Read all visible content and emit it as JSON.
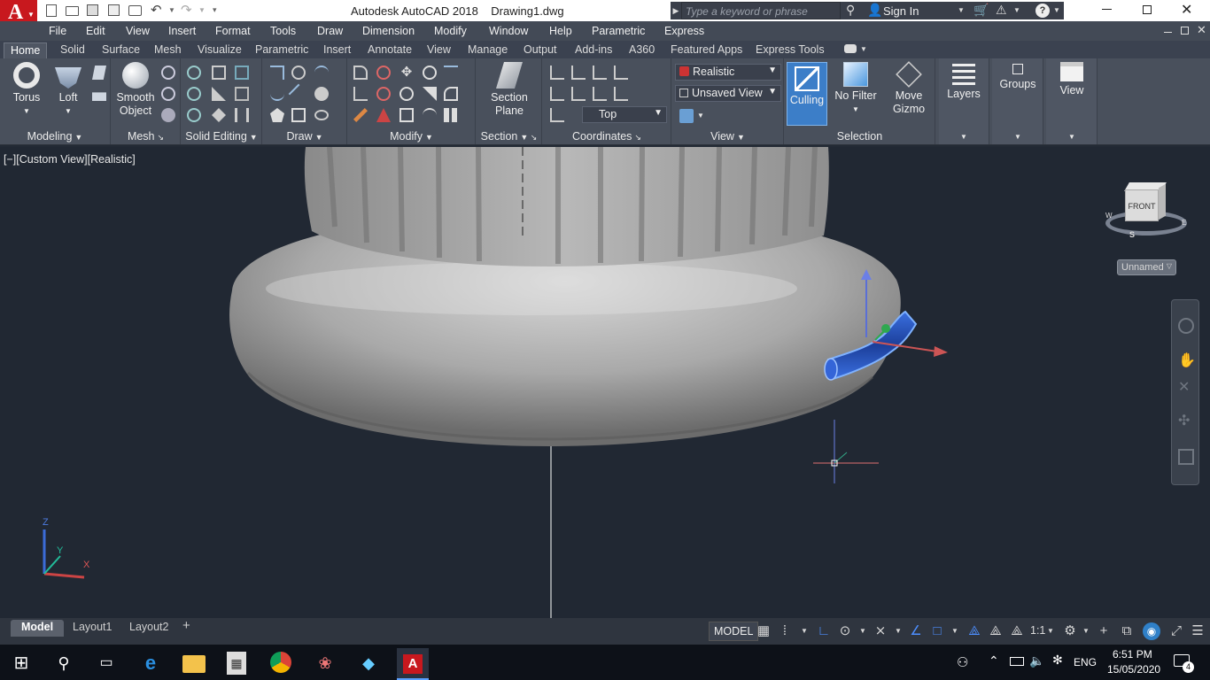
{
  "titlebar": {
    "app_title": "Autodesk AutoCAD 2018",
    "file_name": "Drawing1.dwg",
    "search_placeholder": "Type a keyword or phrase",
    "sign_in": "Sign In",
    "logo_letter": "A"
  },
  "menu": [
    "File",
    "Edit",
    "View",
    "Insert",
    "Format",
    "Tools",
    "Draw",
    "Dimension",
    "Modify",
    "Window",
    "Help",
    "Parametric",
    "Express"
  ],
  "tabs": [
    "Home",
    "Solid",
    "Surface",
    "Mesh",
    "Visualize",
    "Parametric",
    "Insert",
    "Annotate",
    "View",
    "Manage",
    "Output",
    "Add-ins",
    "A360",
    "Featured Apps",
    "Express Tools"
  ],
  "ribbon": {
    "modeling": {
      "label": "Modeling",
      "torus": "Torus",
      "loft": "Loft"
    },
    "mesh": {
      "label": "Mesh",
      "smooth_line1": "Smooth",
      "smooth_line2": "Object"
    },
    "solid_editing": {
      "label": "Solid Editing"
    },
    "draw": {
      "label": "Draw"
    },
    "modify": {
      "label": "Modify"
    },
    "section": {
      "label": "Section",
      "plane_line1": "Section",
      "plane_line2": "Plane"
    },
    "coordinates": {
      "label": "Coordinates",
      "ucs_combo": "Top"
    },
    "view": {
      "label": "View",
      "visual_style": "Realistic",
      "named_view": "Unsaved View"
    },
    "selection": {
      "label": "Selection",
      "culling": "Culling",
      "no_filter": "No Filter",
      "move_gizmo_line1": "Move",
      "move_gizmo_line2": "Gizmo"
    },
    "layers": {
      "label": "Layers"
    },
    "groups": {
      "label": "Groups"
    },
    "view2": {
      "label": "View"
    }
  },
  "viewport": {
    "label": "[−][Custom View][Realistic]",
    "viewcube_face": "FRONT",
    "viewcube_compass_s": "S",
    "viewcube_compass_w": "W",
    "viewcube_compass_e": "E",
    "ucs_dropdown": "Unnamed",
    "ucs_z": "Z",
    "ucs_y": "Y",
    "ucs_x": "X"
  },
  "layout_tabs": [
    "Model",
    "Layout1",
    "Layout2"
  ],
  "status": {
    "model": "MODEL",
    "scale": "1:1"
  },
  "taskbar": {
    "lang": "ENG",
    "time": "6:51 PM",
    "date": "15/05/2020",
    "notif_count": "4"
  },
  "colors": {
    "accent": "#2f80c8",
    "culling_active": "#3c7ec8",
    "viewport_bg": "#212833",
    "selection_blue": "#4d8fff"
  }
}
